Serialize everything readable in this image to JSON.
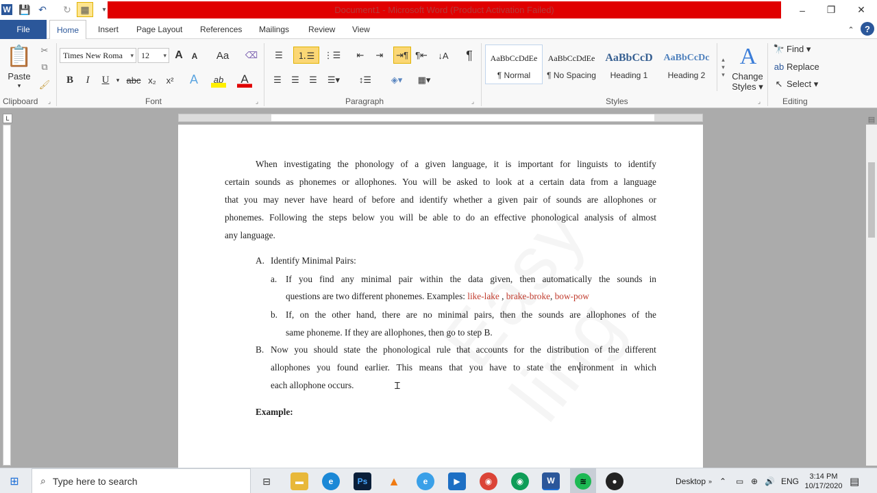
{
  "window": {
    "title": "Document1 - Microsoft Word (Product Activation Failed)",
    "minimize": "–",
    "restore": "❐",
    "close": "✕"
  },
  "ribbon_tabs": [
    "File",
    "Home",
    "Insert",
    "Page Layout",
    "References",
    "Mailings",
    "Review",
    "View"
  ],
  "clipboard": {
    "paste": "Paste",
    "group": "Clipboard"
  },
  "font": {
    "family": "Times New Roma",
    "size": "12",
    "group": "Font",
    "bold": "B",
    "italic": "I",
    "underline": "U",
    "strike": "abc",
    "subscript": "x₂",
    "superscript": "x²",
    "grow": "A",
    "shrink": "A",
    "case": "Aa",
    "font_color": "A",
    "highlight": "ab"
  },
  "paragraph": {
    "group": "Paragraph",
    "pilcrow": "¶"
  },
  "styles": {
    "group": "Styles",
    "items": [
      {
        "sample": "AaBbCcDdEe",
        "name": "¶ Normal"
      },
      {
        "sample": "AaBbCcDdEe",
        "name": "¶ No Spacing"
      },
      {
        "sample": "AaBbCcD",
        "name": "Heading 1"
      },
      {
        "sample": "AaBbCcDc",
        "name": "Heading 2"
      }
    ],
    "change_styles_1": "Change",
    "change_styles_2": "Styles ▾"
  },
  "editing": {
    "group": "Editing",
    "find": "Find ▾",
    "replace": "Replace",
    "select": "Select ▾"
  },
  "document": {
    "p1": [
      [
        "When",
        "investigating",
        "the",
        "phonology",
        "of",
        "a",
        "given",
        "language,",
        "it",
        "is",
        "important",
        "for",
        "linguists",
        "to",
        "identify"
      ],
      [
        "certain",
        "sounds",
        "as",
        "phonemes",
        "or",
        "allophones.",
        "You",
        "will",
        "be",
        "asked",
        "to",
        "look",
        "at",
        "a",
        "certain",
        "data",
        "from",
        "a",
        "language"
      ],
      [
        "that",
        "you",
        "may",
        "never",
        "have",
        "heard",
        "of",
        "before",
        "and",
        "identify",
        "whether",
        "a",
        "given",
        "pair",
        "of",
        "sounds",
        "are",
        "allophones",
        "or"
      ],
      [
        "phonemes.",
        "Following",
        "the",
        "steps",
        "below",
        "you",
        "will",
        "be",
        "able",
        "to",
        "do",
        "an",
        "effective",
        "phonological",
        "analysis",
        "of",
        "almost"
      ]
    ],
    "p1_last": "any language.",
    "A_marker": "A.",
    "A_text": "Identify Minimal Pairs:",
    "a_marker": "a.",
    "a_line1": [
      "If",
      "you",
      "find",
      "any",
      "minimal",
      "pair",
      "within",
      "the",
      "data",
      "given,",
      "then",
      "automatically",
      "the",
      "sounds",
      "in"
    ],
    "a_line2_start": "questions are two different phonemes.  Examples: ",
    "ex1": "like-lake",
    "ex_sep1": " , ",
    "ex2": "brake-broke",
    "ex_sep2": ", ",
    "ex3": "bow-pow",
    "b_marker": "b.",
    "b_line1": [
      "If,",
      "on",
      "the",
      "other",
      "hand,",
      "there",
      "are",
      "no",
      "minimal",
      "pairs,",
      "then",
      "the",
      "sounds",
      "are",
      "allophones",
      "of",
      "the"
    ],
    "b_line2": "same phoneme. If they are allophones, then go to step B.",
    "B_marker": "B.",
    "B_line1": [
      "Now",
      "you",
      "should",
      "state",
      "the",
      "phonological",
      "rule",
      "that",
      "accounts",
      "for",
      "the",
      "distribution",
      "of",
      "the",
      "different"
    ],
    "B_line2": [
      "allophones",
      "you",
      "found",
      "earlier.",
      "This",
      "means",
      "that",
      "you",
      "have",
      "to",
      "state",
      "the",
      "environment",
      "in",
      "which"
    ],
    "B_line3": "each allophone occurs.",
    "example": "Example:",
    "watermark": "Easy ling"
  },
  "taskbar": {
    "search_placeholder": "Type here to search",
    "desktop": "Desktop",
    "language": "ENG",
    "time": "3:14 PM",
    "date": "10/17/2020"
  }
}
